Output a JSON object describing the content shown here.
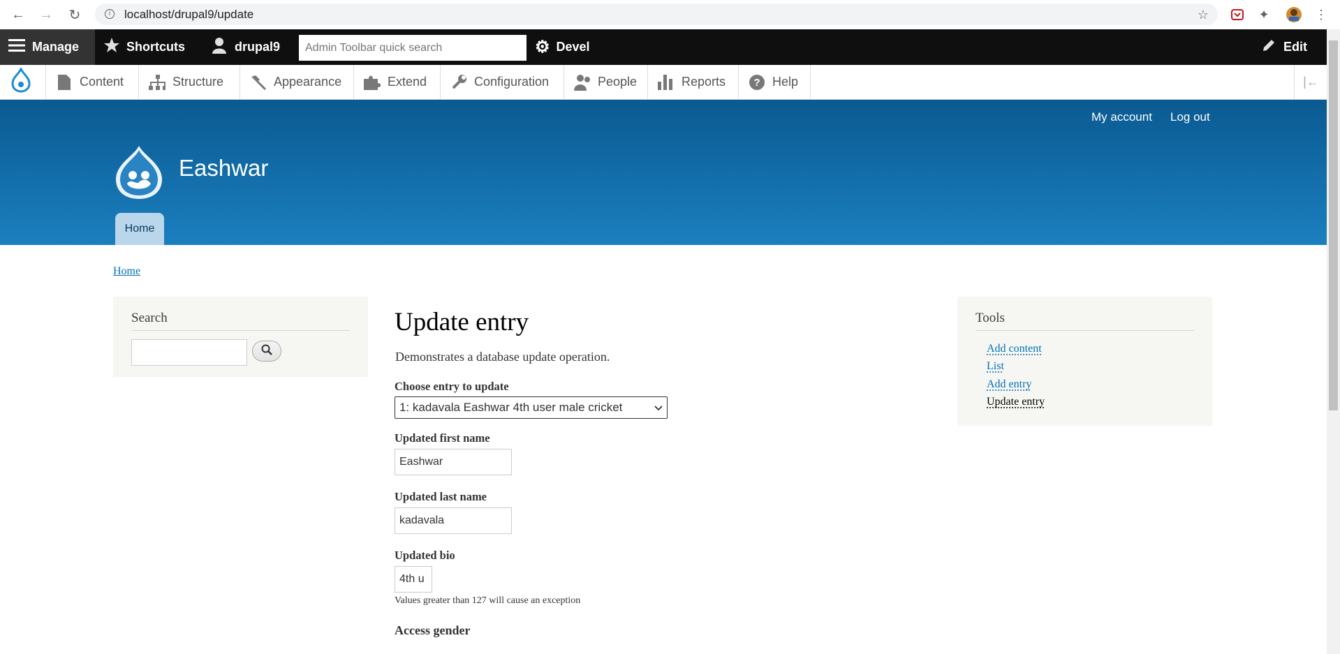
{
  "browser": {
    "url": "localhost/drupal9/update"
  },
  "toolbar": {
    "manage": "Manage",
    "shortcuts": "Shortcuts",
    "user": "drupal9",
    "search_placeholder": "Admin Toolbar quick search",
    "devel": "Devel",
    "edit": "Edit"
  },
  "tray": {
    "items": [
      "Content",
      "Structure",
      "Appearance",
      "Extend",
      "Configuration",
      "People",
      "Reports",
      "Help"
    ]
  },
  "header": {
    "site_name": "Eashwar",
    "my_account": "My account",
    "log_out": "Log out",
    "home_tab": "Home"
  },
  "breadcrumb": "Home",
  "search_block": {
    "title": "Search"
  },
  "tools_block": {
    "title": "Tools",
    "links": [
      "Add content",
      "List",
      "Add entry",
      "Update entry"
    ]
  },
  "main": {
    "title": "Update entry",
    "description": "Demonstrates a database update operation.",
    "choose_label": "Choose entry to update",
    "choose_value": "1: kadavala Eashwar 4th user male cricket",
    "first_name_label": "Updated first name",
    "first_name_value": "Eashwar",
    "last_name_label": "Updated last name",
    "last_name_value": "kadavala",
    "bio_label": "Updated bio",
    "bio_value": "4th u",
    "bio_hint": "Values greater than 127 will cause an exception",
    "gender_label": "Access gender"
  }
}
